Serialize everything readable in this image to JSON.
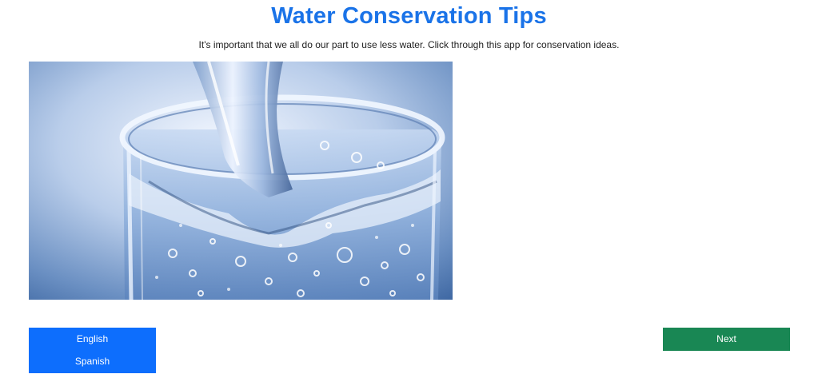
{
  "header": {
    "title": "Water Conservation Tips",
    "subtitle": "It's important that we all do our part to use less water. Click through this app for conservation ideas."
  },
  "hero_image": {
    "icon": "water-glass-image"
  },
  "language_menu": {
    "items": [
      {
        "label": "English"
      },
      {
        "label": "Spanish"
      }
    ]
  },
  "navigation": {
    "next_label": "Next"
  },
  "colors": {
    "title": "#1a73e8",
    "language_buttons": "#0d6efd",
    "next_button": "#198754"
  }
}
